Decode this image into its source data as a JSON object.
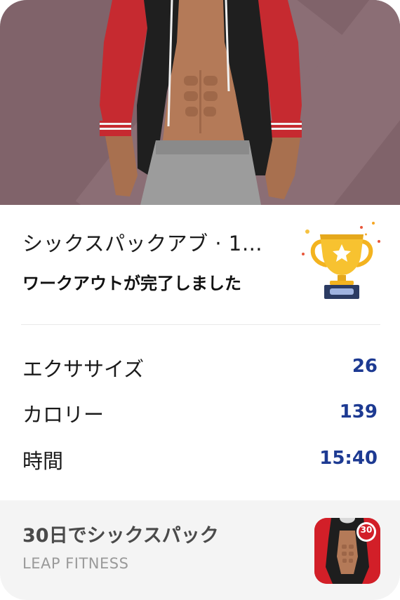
{
  "summary": {
    "title": "シックスパックアブ · 1…",
    "subtitle": "ワークアウトが完了しました"
  },
  "stats": [
    {
      "label": "エクササイズ",
      "value": "26"
    },
    {
      "label": "カロリー",
      "value": "139"
    },
    {
      "label": "時間",
      "value": "15:40"
    }
  ],
  "footer": {
    "app_name": "30日でシックスパック",
    "developer": "LEAP FITNESS",
    "app_icon_badge": "30"
  },
  "colors": {
    "accent": "#1d3a92",
    "hero_bg": "#80636a",
    "jacket_red": "#c62a30"
  },
  "icons": [
    "trophy-icon",
    "app-icon"
  ]
}
